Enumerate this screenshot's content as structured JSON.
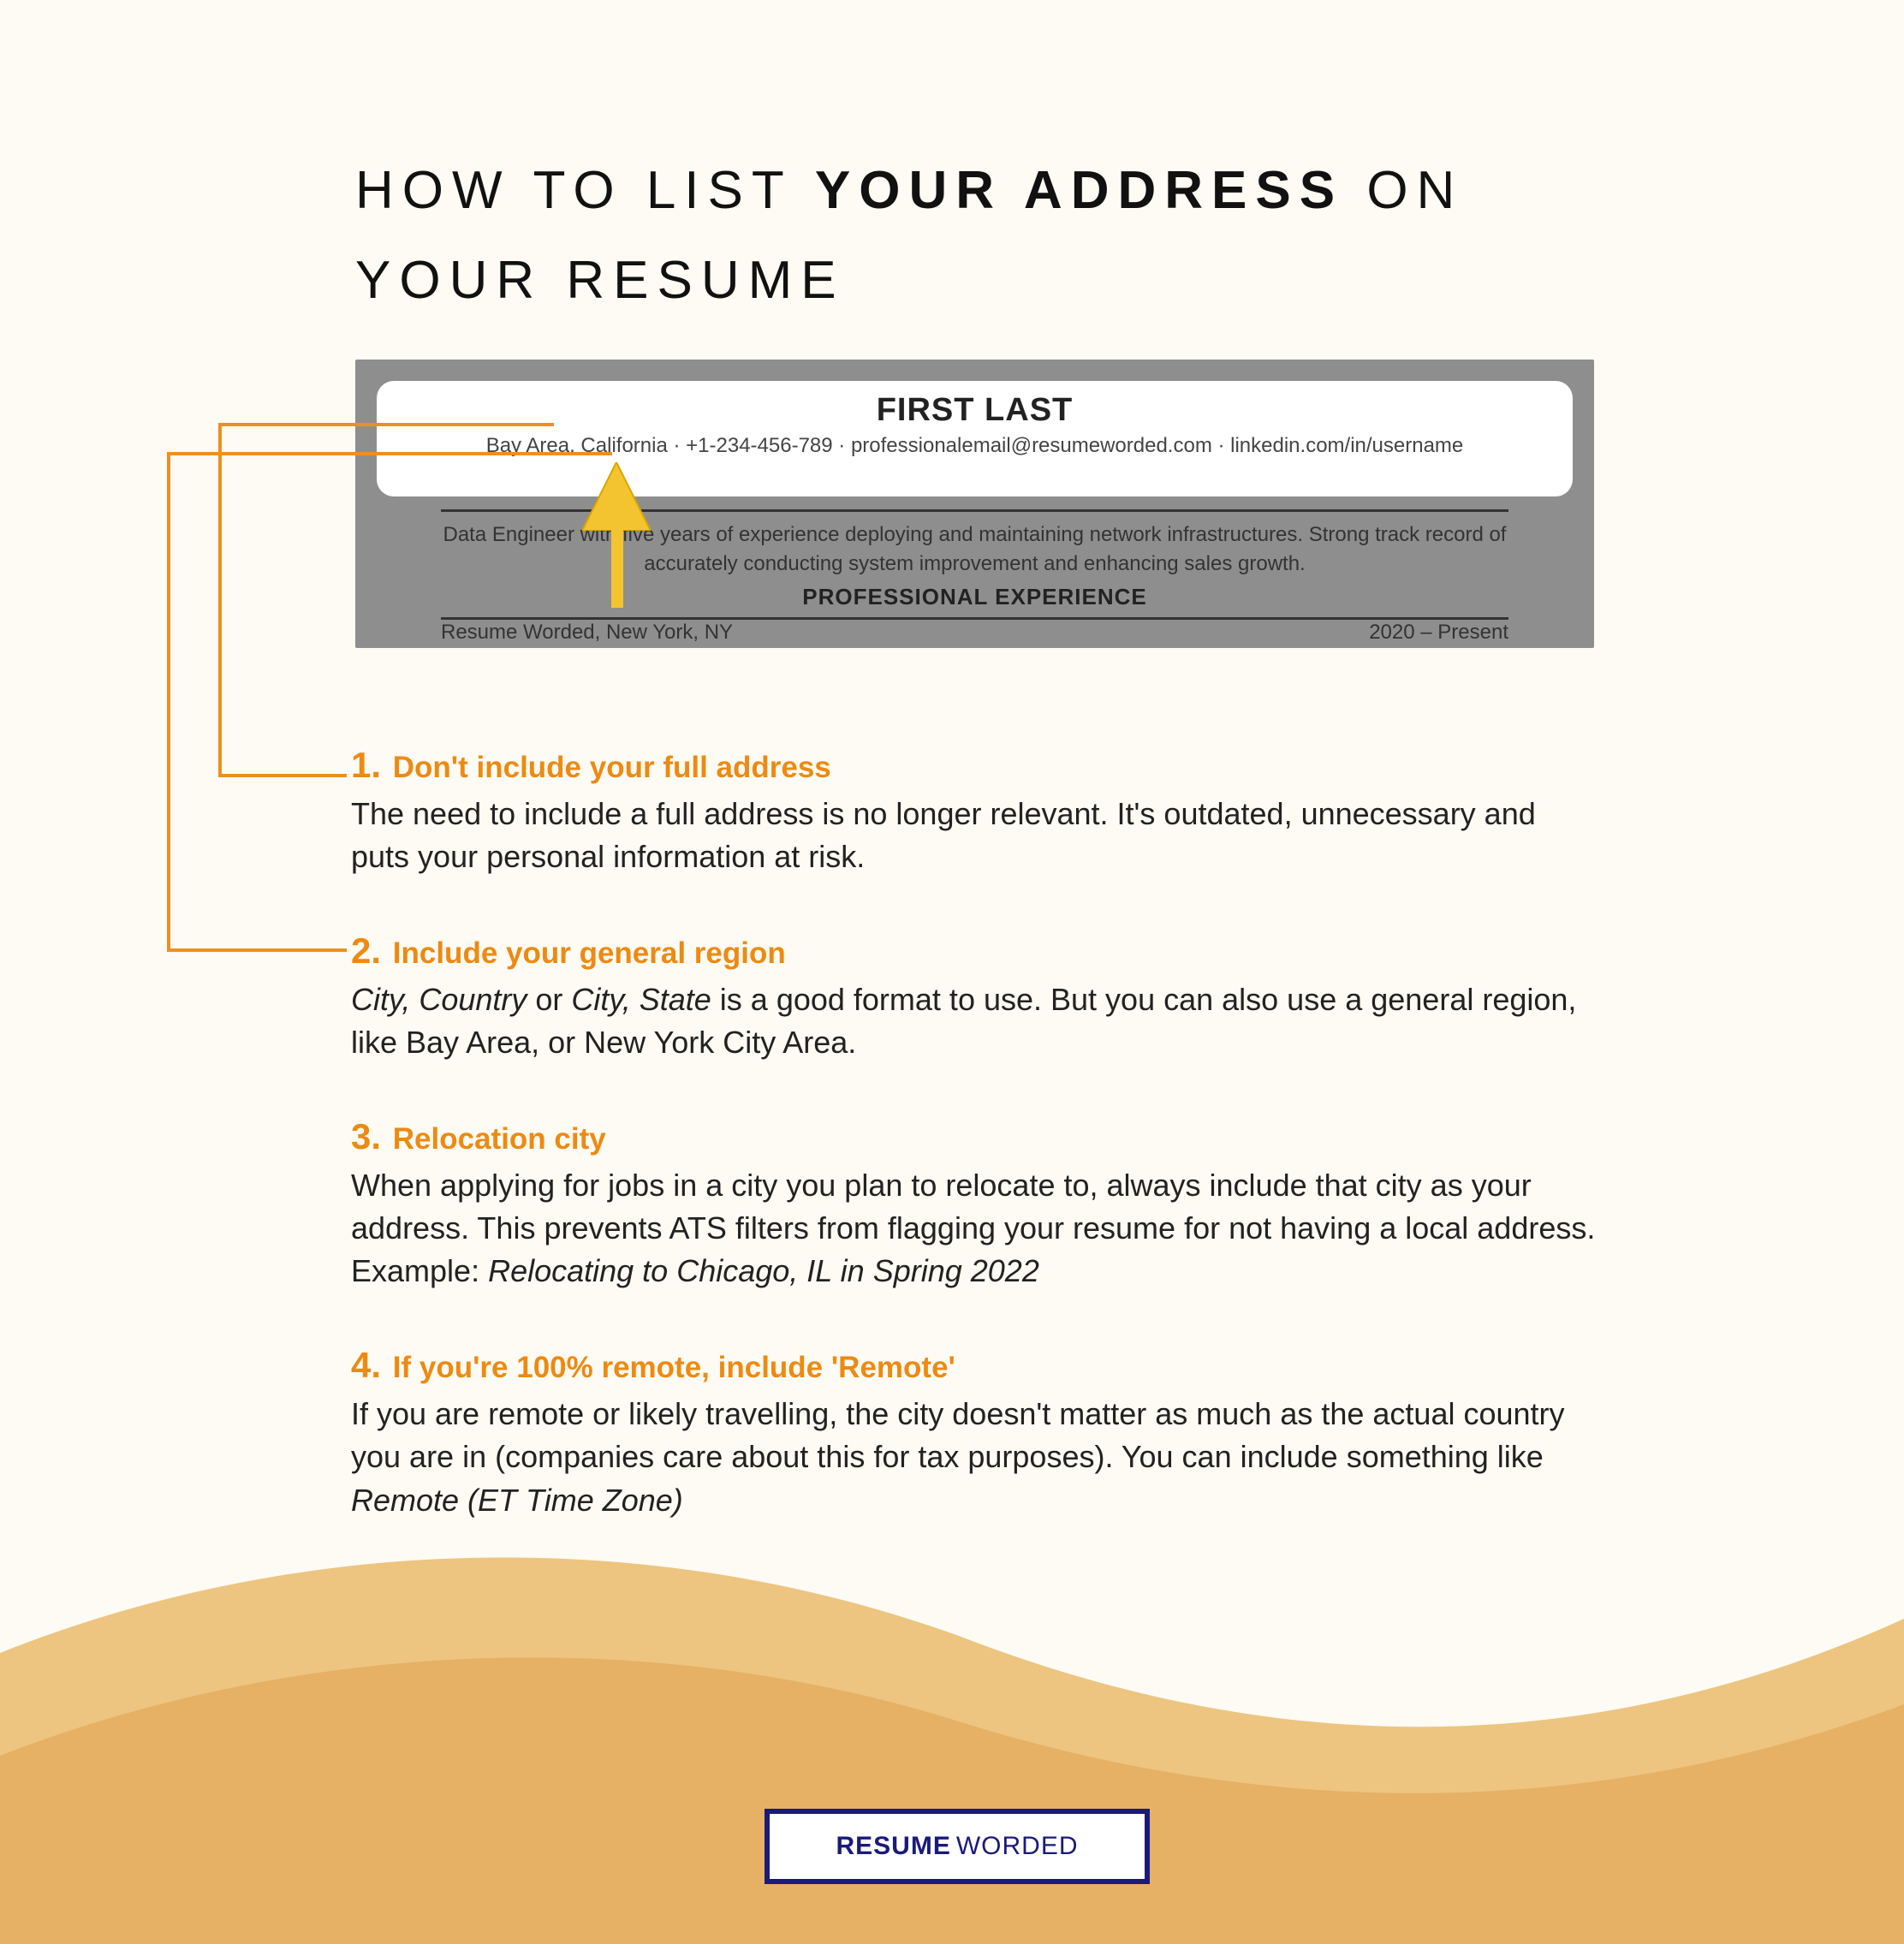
{
  "title": {
    "part1": "HOW TO LIST ",
    "bold": "YOUR ADDRESS",
    "part2": " ON YOUR RESUME"
  },
  "snippet": {
    "name": "FIRST LAST",
    "contact": "Bay Area, California · +1-234-456-789 · professionalemail@resumeworded.com · linkedin.com/in/username",
    "summary": "Data Engineer with five years of experience deploying and maintaining network infrastructures. Strong track record of accurately conducting system improvement and enhancing sales growth.",
    "prof_heading": "PROFESSIONAL EXPERIENCE",
    "job_company": "Resume Worded, New York, NY",
    "job_dates": "2020 – Present"
  },
  "tips": [
    {
      "num": "1.",
      "heading": "Don't include your full address",
      "body": "The need to include a full address is no longer relevant. It's outdated, unnecessary and puts your personal information at risk."
    },
    {
      "num": "2.",
      "heading": "Include your general region",
      "body_prefix_italic1": "City, Country",
      "body_mid1": " or ",
      "body_prefix_italic2": "City, State",
      "body_rest": "  is a good format to use. But you can also use a general region, like Bay Area, or New York City Area."
    },
    {
      "num": "3.",
      "heading": "Relocation city",
      "body": "When applying for jobs in a city you plan to relocate to, always include that city as your address. This prevents ATS filters from flagging your resume for not having a local address. Example: ",
      "body_italic_tail": "Relocating to Chicago, IL in Spring 2022"
    },
    {
      "num": "4.",
      "heading": "If you're 100% remote, include 'Remote'",
      "body": "If you are remote or likely travelling, the city doesn't matter as much as the actual country you are in (companies care about this for tax purposes). You can include something like ",
      "body_italic_tail": "Remote (ET Time Zone)"
    }
  ],
  "logo": {
    "r": "RESUME",
    "w": "WORDED"
  }
}
